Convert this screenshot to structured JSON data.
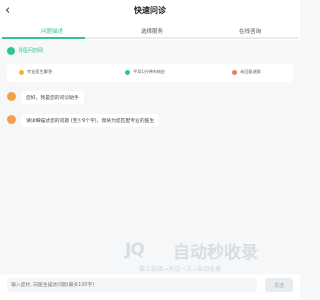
{
  "header": {
    "back_icon": "chevron-left-icon",
    "title": "快速问诊"
  },
  "steps": {
    "items": [
      {
        "label": "问题描述"
      },
      {
        "label": "选择服务"
      },
      {
        "label": "在线咨询"
      }
    ],
    "active_index": 0,
    "progress": 0.28
  },
  "brand": {
    "name": "寻医问药网",
    "color": "#34c48b"
  },
  "features": [
    {
      "label": "专业医生解答",
      "icon": "badge-icon",
      "color": "#f5b13d"
    },
    {
      "label": "平均1分钟内响应",
      "icon": "lightning-icon",
      "color": "#34c48b"
    },
    {
      "label": "未回复退款",
      "icon": "refund-icon",
      "color": "#f07c5a"
    }
  ],
  "chat": [
    {
      "text": "您好，我是您的问诊助手"
    },
    {
      "text": "请详细描述您的问题 (至少9个字)，我将为您匹配专业的医生"
    }
  ],
  "watermark": {
    "logo": "JQ",
    "text": "自动秒收录",
    "subtitle": "做上链接→来访一次→自动收录"
  },
  "input": {
    "placeholder": "输入症状, 向医生描述问题(最多100字)",
    "send_label": "发送"
  },
  "colors": {
    "accent": "#34c48b",
    "background": "#f6f7f9"
  }
}
